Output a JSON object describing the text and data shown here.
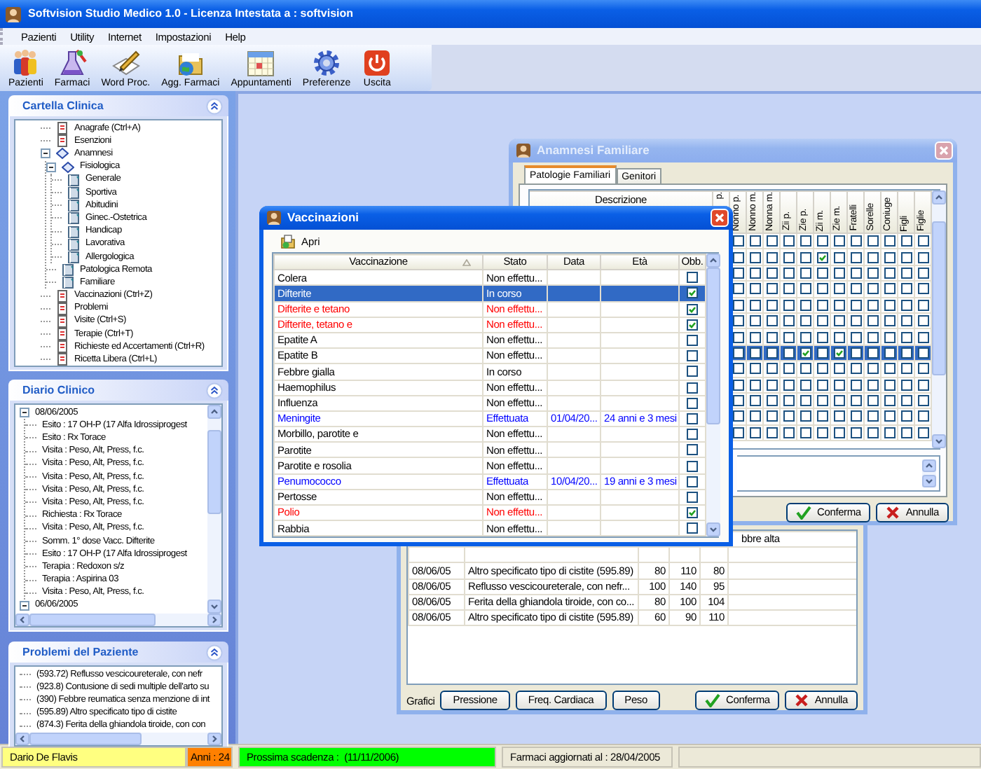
{
  "window": {
    "title": "Softvision Studio Medico 1.0 - Licenza Intestata a : softvision"
  },
  "menu": [
    "Pazienti",
    "Utility",
    "Internet",
    "Impostazioni",
    "Help"
  ],
  "toolbar": [
    "Pazienti",
    "Farmaci",
    "Word Proc.",
    "Agg. Farmaci",
    "Appuntamenti",
    "Preferenze",
    "Uscita"
  ],
  "cartella": {
    "title": "Cartella Clinica",
    "items": [
      {
        "label": "Anagrafe (Ctrl+A)",
        "kind": "entry"
      },
      {
        "label": "Esenzioni",
        "kind": "entry"
      },
      {
        "label": "Anamnesi",
        "kind": "section",
        "expanded": true,
        "children": [
          {
            "label": "Fisiologica",
            "kind": "section",
            "expanded": true,
            "children": [
              {
                "label": "Generale",
                "kind": "page"
              },
              {
                "label": "Sportiva",
                "kind": "page"
              },
              {
                "label": "Abitudini",
                "kind": "page"
              },
              {
                "label": "Ginec.-Ostetrica",
                "kind": "page"
              },
              {
                "label": "Handicap",
                "kind": "page"
              },
              {
                "label": "Lavorativa",
                "kind": "page"
              },
              {
                "label": "Allergologica",
                "kind": "page"
              }
            ]
          },
          {
            "label": "Patologica Remota",
            "kind": "page"
          },
          {
            "label": "Familiare",
            "kind": "page"
          }
        ]
      },
      {
        "label": "Vaccinazioni (Ctrl+Z)",
        "kind": "entry"
      },
      {
        "label": "Problemi",
        "kind": "entry"
      },
      {
        "label": "Visite (Ctrl+S)",
        "kind": "entry"
      },
      {
        "label": "Terapie (Ctrl+T)",
        "kind": "entry"
      },
      {
        "label": "Richieste ed Accertamenti (Ctrl+R)",
        "kind": "entry"
      },
      {
        "label": "Ricetta Libera (Ctrl+L)",
        "kind": "entry"
      }
    ]
  },
  "diario": {
    "title": "Diario Clinico",
    "items": [
      {
        "label": "08/06/2005",
        "expanded": true,
        "children": [
          "Esito : 17 OH-P (17 Alfa Idrossiprogest",
          "Esito : Rx Torace",
          "Visita : Peso, Alt, Press, f.c.",
          "Visita : Peso, Alt, Press, f.c.",
          "Visita : Peso, Alt, Press, f.c.",
          "Visita : Peso, Alt, Press, f.c.",
          "Visita : Peso, Alt, Press, f.c.",
          "Richiesta : Rx Torace",
          "Visita : Peso, Alt, Press, f.c.",
          "Somm. 1° dose Vacc. Difterite",
          "Esito : 17 OH-P (17 Alfa Idrossiprogest",
          "Terapia : Redoxon s/z",
          "Terapia : Aspirina 03",
          "Visita : Peso, Alt, Press, f.c."
        ]
      },
      {
        "label": "06/06/2005",
        "expanded": true
      }
    ]
  },
  "problemi": {
    "title": "Problemi del Paziente",
    "items": [
      "(593.72) Reflusso vescicoureterale, con nefr",
      "(923.8) Contusione di sedi multiple dell'arto su",
      "(390) Febbre reumatica senza menzione di int",
      "(595.89) Altro specificato tipo di cistite",
      "(874.3) Ferita della ghiandola tiroide, con con"
    ]
  },
  "visite": {
    "partial_rows": [
      {
        "note": "bbre alta"
      }
    ],
    "rows": [
      {
        "date": "08/06/05",
        "problem": "Altro specificato tipo di cistite (595.89)",
        "values": [
          "80",
          "110",
          "80"
        ]
      },
      {
        "date": "08/06/05",
        "problem": "Reflusso vescicoureterale, con nefr...",
        "values": [
          "100",
          "140",
          "95"
        ]
      },
      {
        "date": "08/06/05",
        "problem": "Ferita della ghiandola tiroide, con co...",
        "values": [
          "80",
          "100",
          "104"
        ]
      },
      {
        "date": "08/06/05",
        "problem": "Altro specificato tipo di cistite (595.89)",
        "values": [
          "60",
          "90",
          "110"
        ]
      }
    ],
    "charts_label": "Grafici",
    "chart_buttons": [
      "Pressione",
      "Freq. Cardiaca",
      "Peso"
    ],
    "buttons": [
      {
        "label": "Conferma",
        "kind": "confirm"
      },
      {
        "label": "Annulla",
        "kind": "cancel"
      }
    ]
  },
  "anamnesi": {
    "title": "Anamnesi Familiare",
    "tabs": [
      {
        "label": "Patologie Familiari",
        "selected": true
      },
      {
        "label": "Genitori",
        "selected": false
      }
    ],
    "description_header": "Descrizione",
    "columns": [
      "p.",
      "Nonno p.",
      "Nonno m.",
      "Nonna m.",
      "Zii p.",
      "Zie p.",
      "Zii m.",
      "Zie m.",
      "Fratelli",
      "Sorelle",
      "Coniuge",
      "Figli",
      "Figlie"
    ],
    "rows": [
      {
        "selected": false,
        "checks": [
          false,
          false,
          false,
          false,
          false,
          false,
          false,
          false,
          false,
          false,
          false,
          false
        ]
      },
      {
        "selected": false,
        "checks": [
          false,
          false,
          false,
          false,
          false,
          true,
          false,
          false,
          false,
          false,
          false,
          false
        ]
      },
      {
        "selected": false,
        "checks": [
          false,
          false,
          false,
          false,
          false,
          false,
          false,
          false,
          false,
          false,
          false,
          false
        ]
      },
      {
        "selected": false,
        "checks": [
          false,
          false,
          false,
          false,
          false,
          false,
          false,
          false,
          false,
          false,
          false,
          false
        ]
      },
      {
        "selected": false,
        "checks": [
          false,
          false,
          false,
          false,
          false,
          false,
          false,
          false,
          false,
          false,
          false,
          false
        ]
      },
      {
        "selected": false,
        "checks": [
          false,
          false,
          false,
          false,
          false,
          false,
          false,
          false,
          false,
          false,
          false,
          false
        ]
      },
      {
        "selected": false,
        "checks": [
          false,
          false,
          false,
          false,
          false,
          false,
          false,
          false,
          false,
          false,
          false,
          false
        ]
      },
      {
        "selected": true,
        "checks": [
          false,
          false,
          false,
          false,
          true,
          false,
          true,
          false,
          false,
          false,
          false,
          false
        ]
      },
      {
        "selected": false,
        "checks": [
          false,
          false,
          false,
          false,
          false,
          false,
          false,
          false,
          false,
          false,
          false,
          false
        ]
      },
      {
        "selected": false,
        "checks": [
          false,
          false,
          false,
          false,
          false,
          false,
          false,
          false,
          false,
          false,
          false,
          false
        ]
      },
      {
        "selected": false,
        "checks": [
          false,
          false,
          false,
          false,
          false,
          false,
          false,
          false,
          false,
          false,
          false,
          false
        ]
      },
      {
        "selected": false,
        "checks": [
          false,
          false,
          false,
          false,
          false,
          false,
          false,
          false,
          false,
          false,
          false,
          false
        ]
      },
      {
        "selected": false,
        "checks": [
          false,
          false,
          false,
          false,
          false,
          false,
          false,
          false,
          false,
          false,
          false,
          false
        ]
      }
    ],
    "buttons": [
      {
        "label": "Conferma",
        "kind": "confirm"
      },
      {
        "label": "Annulla",
        "kind": "cancel"
      }
    ]
  },
  "vaccinazioni": {
    "title": "Vaccinazioni",
    "open_button": "Apri",
    "columns": [
      "Vaccinazione",
      "Stato",
      "Data",
      "Età",
      "Obb."
    ],
    "rows": [
      {
        "name": "Colera",
        "status": "Non effettu...",
        "mandatory": false,
        "selected": false,
        "color": "#000000"
      },
      {
        "name": "Difterite",
        "status": "In corso",
        "mandatory": true,
        "selected": true
      },
      {
        "name": "Difterite e tetano",
        "status": "Non effettu...",
        "mandatory": true,
        "selected": false,
        "color": "#ff0000"
      },
      {
        "name": "Difterite, tetano e",
        "status": "Non effettu...",
        "mandatory": true,
        "selected": false,
        "color": "#ff0000"
      },
      {
        "name": "Epatite A",
        "status": "Non effettu...",
        "mandatory": false,
        "selected": false,
        "color": "#000000"
      },
      {
        "name": "Epatite B",
        "status": "Non effettu...",
        "mandatory": false,
        "selected": false,
        "color": "#000000"
      },
      {
        "name": "Febbre gialla",
        "status": "In corso",
        "mandatory": false,
        "selected": false,
        "color": "#000000"
      },
      {
        "name": "Haemophilus",
        "status": "Non effettu...",
        "mandatory": false,
        "selected": false,
        "color": "#000000"
      },
      {
        "name": "Influenza",
        "status": "Non effettu...",
        "mandatory": false,
        "selected": false,
        "color": "#000000"
      },
      {
        "name": "Meningite",
        "status": "Effettuata",
        "date": "01/04/20...",
        "age": "24 anni e 3 mesi",
        "mandatory": false,
        "selected": false,
        "color": "#0000ff"
      },
      {
        "name": "Morbillo, parotite e",
        "status": "Non effettu...",
        "mandatory": false,
        "selected": false,
        "color": "#000000"
      },
      {
        "name": "Parotite",
        "status": "Non effettu...",
        "mandatory": false,
        "selected": false,
        "color": "#000000"
      },
      {
        "name": "Parotite e rosolia",
        "status": "Non effettu...",
        "mandatory": false,
        "selected": false,
        "color": "#000000"
      },
      {
        "name": "Penumococco",
        "status": "Effettuata",
        "date": "10/04/20...",
        "age": "19 anni e 3 mesi",
        "mandatory": false,
        "selected": false,
        "color": "#0000ff"
      },
      {
        "name": "Pertosse",
        "status": "Non effettu...",
        "mandatory": false,
        "selected": false,
        "color": "#000000"
      },
      {
        "name": "Polio",
        "status": "Non effettu...",
        "mandatory": true,
        "selected": false,
        "color": "#ff0000"
      },
      {
        "name": "Rabbia",
        "status": "Non effettu...",
        "mandatory": false,
        "selected": false,
        "color": "#000000"
      }
    ]
  },
  "status_bar": {
    "patient": "Dario De Flavis",
    "age": "Anni : 24",
    "next_due": "Prossima scadenza :  (11/11/2006)",
    "drugs_updated": "Farmaci aggiornati al : 28/04/2005"
  }
}
